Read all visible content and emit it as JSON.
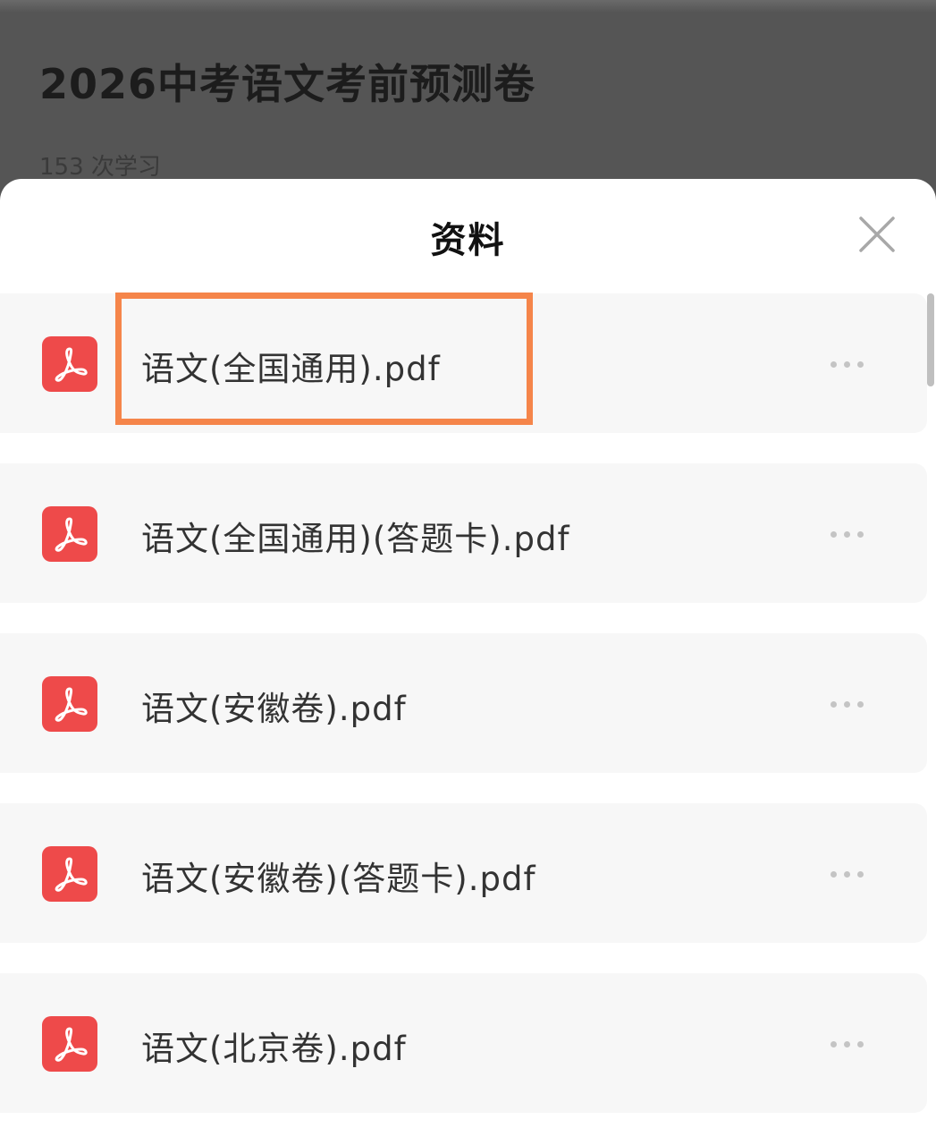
{
  "background_page": {
    "title": "2026中考语文考前预测卷",
    "study_count": "153 次学习"
  },
  "sheet": {
    "title": "资料",
    "close_icon": "close-icon",
    "files": [
      {
        "name": "语文(全国通用).pdf",
        "icon": "pdf-icon",
        "highlighted": true
      },
      {
        "name": "语文(全国通用)(答题卡).pdf",
        "icon": "pdf-icon",
        "highlighted": false
      },
      {
        "name": "语文(安徽卷).pdf",
        "icon": "pdf-icon",
        "highlighted": false
      },
      {
        "name": "语文(安徽卷)(答题卡).pdf",
        "icon": "pdf-icon",
        "highlighted": false
      },
      {
        "name": "语文(北京卷).pdf",
        "icon": "pdf-icon",
        "highlighted": false
      }
    ]
  },
  "colors": {
    "pdf_icon": "#ee4a4a",
    "highlight_border": "#f5854a",
    "overlay": "#555555",
    "row_background": "#f7f7f7"
  }
}
